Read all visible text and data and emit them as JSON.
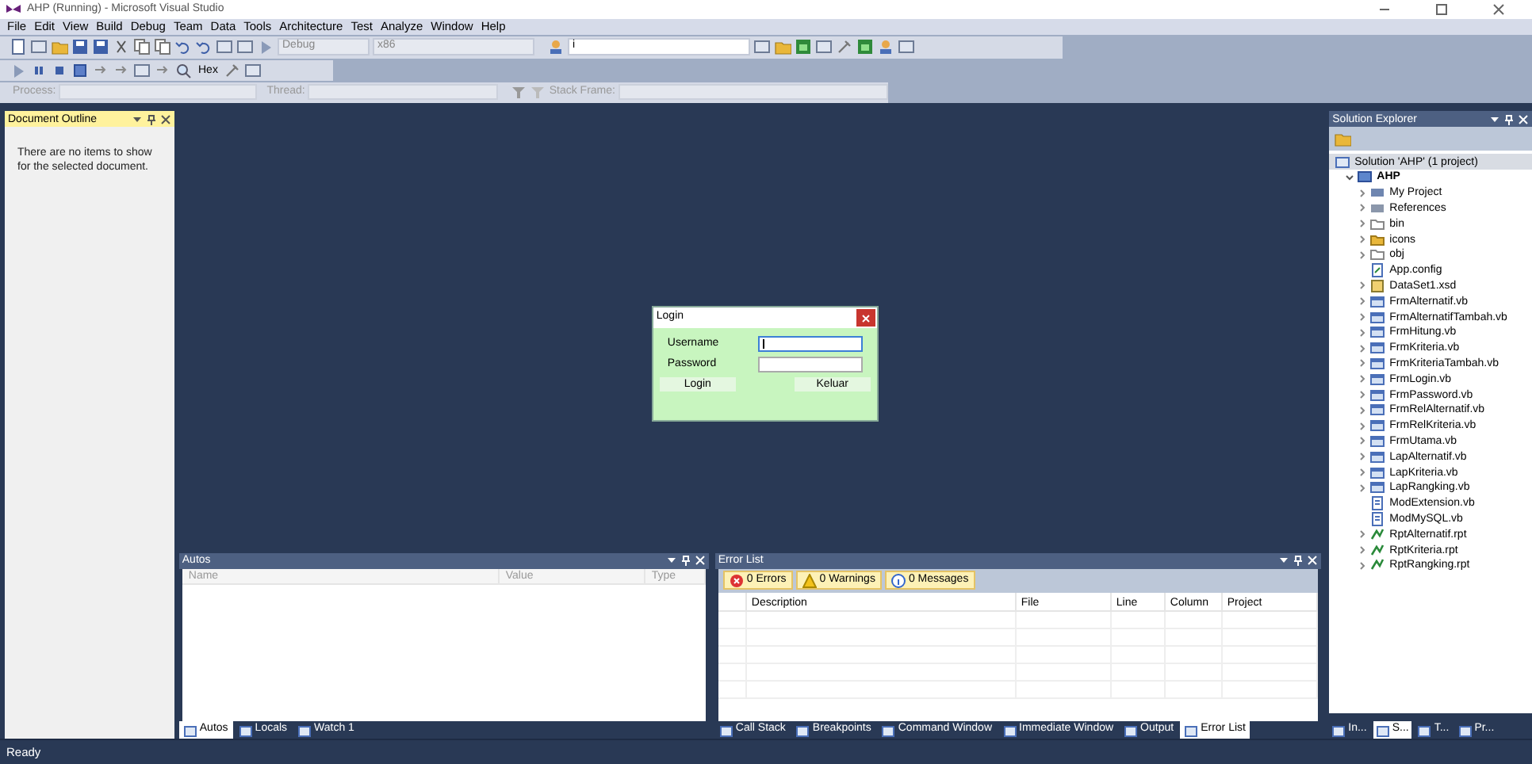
{
  "window": {
    "title": "AHP (Running) - Microsoft Visual Studio"
  },
  "menu": [
    "File",
    "Edit",
    "View",
    "Build",
    "Debug",
    "Team",
    "Data",
    "Tools",
    "Architecture",
    "Test",
    "Analyze",
    "Window",
    "Help"
  ],
  "toolbars": {
    "configuration": "Debug",
    "platform": "x86",
    "find": "i",
    "hex": "Hex",
    "process_label": "Process:",
    "thread_label": "Thread:",
    "stack_frame_label": "Stack Frame:"
  },
  "document_outline": {
    "title": "Document Outline",
    "active": true,
    "message": "There are no items to show for the selected document."
  },
  "login_dialog": {
    "title": "Login",
    "fields": [
      {
        "label": "Username",
        "focused": true
      },
      {
        "label": "Password",
        "focused": false
      }
    ],
    "buttons": [
      "Login",
      "Keluar"
    ]
  },
  "autos": {
    "title": "Autos",
    "active": false,
    "columns": [
      "Name",
      "Value",
      "Type"
    ],
    "tabs": [
      {
        "label": "Autos",
        "selected": true
      },
      {
        "label": "Locals",
        "selected": false
      },
      {
        "label": "Watch 1",
        "selected": false
      }
    ]
  },
  "error_list": {
    "title": "Error List",
    "active": false,
    "filters": [
      {
        "kind": "error",
        "label": "0 Errors",
        "selected": true
      },
      {
        "kind": "warning",
        "label": "0 Warnings",
        "selected": true
      },
      {
        "kind": "message",
        "label": "0 Messages",
        "selected": true
      }
    ],
    "columns": [
      "Description",
      "File",
      "Line",
      "Column",
      "Project"
    ],
    "tabs": [
      {
        "label": "Call Stack",
        "selected": false
      },
      {
        "label": "Breakpoints",
        "selected": false
      },
      {
        "label": "Command Window",
        "selected": false
      },
      {
        "label": "Immediate Window",
        "selected": false
      },
      {
        "label": "Output",
        "selected": false
      },
      {
        "label": "Error List",
        "selected": true
      }
    ]
  },
  "solution_explorer": {
    "title": "Solution Explorer",
    "active": false,
    "tree": [
      {
        "label": "Solution 'AHP' (1 project)",
        "kind": "solution",
        "selected": true,
        "children": [
          {
            "label": "AHP",
            "kind": "project",
            "expanded": true,
            "selected": false,
            "children": [
              {
                "label": "My Project",
                "kind": "properties",
                "expanded": false,
                "selected": false
              },
              {
                "label": "References",
                "kind": "references",
                "expanded": false,
                "selected": false
              },
              {
                "label": "bin",
                "kind": "folder",
                "expanded": false,
                "selected": false
              },
              {
                "label": "icons",
                "kind": "folder-filled",
                "expanded": false,
                "selected": false
              },
              {
                "label": "obj",
                "kind": "folder",
                "expanded": false,
                "selected": false
              },
              {
                "label": "App.config",
                "kind": "config",
                "selected": false
              },
              {
                "label": "DataSet1.xsd",
                "kind": "dataset",
                "expanded": false,
                "selected": false
              },
              {
                "label": "FrmAlternatif.vb",
                "kind": "form",
                "expanded": false,
                "selected": false
              },
              {
                "label": "FrmAlternatifTambah.vb",
                "kind": "form",
                "expanded": false,
                "selected": false
              },
              {
                "label": "FrmHitung.vb",
                "kind": "form",
                "expanded": false,
                "selected": false
              },
              {
                "label": "FrmKriteria.vb",
                "kind": "form",
                "expanded": false,
                "selected": false
              },
              {
                "label": "FrmKriteriaTambah.vb",
                "kind": "form",
                "expanded": false,
                "selected": false
              },
              {
                "label": "FrmLogin.vb",
                "kind": "form",
                "expanded": false,
                "selected": false
              },
              {
                "label": "FrmPassword.vb",
                "kind": "form",
                "expanded": false,
                "selected": false
              },
              {
                "label": "FrmRelAlternatif.vb",
                "kind": "form",
                "expanded": false,
                "selected": false
              },
              {
                "label": "FrmRelKriteria.vb",
                "kind": "form",
                "expanded": false,
                "selected": false
              },
              {
                "label": "FrmUtama.vb",
                "kind": "form",
                "expanded": false,
                "selected": false
              },
              {
                "label": "LapAlternatif.vb",
                "kind": "form",
                "expanded": false,
                "selected": false
              },
              {
                "label": "LapKriteria.vb",
                "kind": "form",
                "expanded": false,
                "selected": false
              },
              {
                "label": "LapRangking.vb",
                "kind": "form",
                "expanded": false,
                "selected": false
              },
              {
                "label": "ModExtension.vb",
                "kind": "module",
                "selected": false
              },
              {
                "label": "ModMySQL.vb",
                "kind": "module",
                "selected": false
              },
              {
                "label": "RptAlternatif.rpt",
                "kind": "report",
                "expanded": false,
                "selected": false
              },
              {
                "label": "RptKriteria.rpt",
                "kind": "report",
                "expanded": false,
                "selected": false
              },
              {
                "label": "RptRangking.rpt",
                "kind": "report",
                "expanded": false,
                "selected": false
              }
            ]
          }
        ]
      }
    ]
  },
  "right_tabs": [
    {
      "label": "In...",
      "selected": false
    },
    {
      "label": "S...",
      "selected": true
    },
    {
      "label": "T...",
      "selected": false
    },
    {
      "label": "Pr...",
      "selected": false
    }
  ],
  "status_bar": "Ready"
}
